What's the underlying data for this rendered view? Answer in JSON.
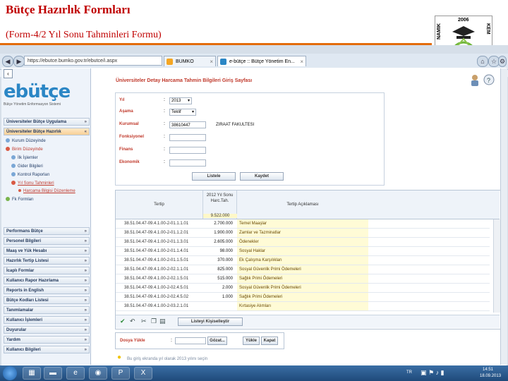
{
  "slide": {
    "title": "Bütçe Hazırlık Formları",
    "subtitle": "(Form-4/2 Yıl Sonu Tahminleri Formu)",
    "logo_year": "2006",
    "logo_left": "NAMIK",
    "logo_right": "KEM"
  },
  "browser": {
    "url": "https://ebutce.bumko.gov.tr/ebutce/i.aspx",
    "tabs": [
      {
        "label": "BUMKO"
      },
      {
        "label": "e-bütçe :: Bütçe Yönetim En..."
      }
    ]
  },
  "sidebar": {
    "brand": "ebütçe",
    "brand_sub": "Bütçe Yönetim Enformasyon Sistemi",
    "sections_top": [
      {
        "label": "Üniversiteler Bütçe Uygulama"
      },
      {
        "label": "Üniversiteler Bütçe Hazırlık"
      }
    ],
    "tree": [
      {
        "label": "Kurum Düzeyinde"
      },
      {
        "label": "Birim Düzeyinde"
      },
      {
        "label": "İlk İşlemler"
      },
      {
        "label": "Gider Bilgileri"
      },
      {
        "label": "Kontrol Raporları"
      },
      {
        "label": "Yıl Sonu Tahminleri"
      },
      {
        "label": "Harcama Bilgisi Düzenleme"
      },
      {
        "label": "Fk Formları"
      }
    ],
    "sections_bottom": [
      {
        "label": "Performans Bütçe"
      },
      {
        "label": "Personel Bilgileri"
      },
      {
        "label": "Maaş ve Yük Hesabı"
      },
      {
        "label": "Hazırlık Tertip Listesi"
      },
      {
        "label": "İcaplı Formlar"
      },
      {
        "label": "Kullanıcı Rapor Hazırlama"
      },
      {
        "label": "Reports in English"
      },
      {
        "label": "Bütçe Kodları Listesi"
      },
      {
        "label": "Tanımlamalar"
      },
      {
        "label": "Kullanıcı İşlemleri"
      },
      {
        "label": "Duyurular"
      },
      {
        "label": "Yardım"
      },
      {
        "label": "Kullanıcı Bilgileri"
      }
    ]
  },
  "form": {
    "heading": "Üniversiteler Detay Harcama Tahmin Bilgileri Giriş Sayfası",
    "fields": {
      "yil_label": "Yıl",
      "yil_value": "2013",
      "asama_label": "Aşama",
      "asama_value": "Teklif",
      "kurumsal_label": "Kurumsal",
      "kurumsal_value": "38610447",
      "kurumsal_name": "ZIRAAT FAKULTESI",
      "fonksiyonel_label": "Fonksiyonel",
      "finans_label": "Finans",
      "ekonomik_label": "Ekonomik"
    },
    "list_button": "Listele",
    "save_button": "Kaydet"
  },
  "grid": {
    "col_tertip": "Tertip",
    "col_value": "2012 Yıl Sonu Harc.Tah.",
    "col_total": "9.522.000",
    "col_desc": "Tertip Açıklaması",
    "rows": [
      {
        "tertip": "38.51.04.47-09.4.1.00-2-01.1.1.01",
        "value": "2.700.000",
        "desc": "Temel Maaşlar"
      },
      {
        "tertip": "38.51.04.47-09.4.1.00-2-01.1.2.01",
        "value": "1.900.000",
        "desc": "Zamlar ve Tazminatlar"
      },
      {
        "tertip": "38.51.04.47-09.4.1.00-2-01.1.3.01",
        "value": "2.605.000",
        "desc": "Ödenekler"
      },
      {
        "tertip": "38.51.04.47-09.4.1.00-2-01.1.4.01",
        "value": "98.000",
        "desc": "Sosyal Haklar"
      },
      {
        "tertip": "38.51.04.47-09.4.1.00-2-01.1.5.01",
        "value": "370.000",
        "desc": "Ek Çalışma Karşılıkları"
      },
      {
        "tertip": "38.51.04.47-09.4.1.00-2-02.1.1.01",
        "value": "825.000",
        "desc": "Sosyal Güvenlik Primi Ödemeleri"
      },
      {
        "tertip": "38.51.04.47-09.4.1.00-2-02.1.5.01",
        "value": "515.000",
        "desc": "Sağlık Primi Ödemeleri"
      },
      {
        "tertip": "38.51.04.47-09.4.1.00-2-02.4.5.01",
        "value": "2.000",
        "desc": "Sosyal Güvenlik Primi Ödemeleri"
      },
      {
        "tertip": "38.51.04.47-09.4.1.00-2-02.4.5.02",
        "value": "1.000",
        "desc": "Sağlık Primi Ödemeleri"
      },
      {
        "tertip": "38.51.04.47-09.4.1.00-2-03.2.1.01",
        "value": "",
        "desc": "Kırtasiye Alımları"
      }
    ],
    "tools_label": "Listeyi Kişiselleştir"
  },
  "upload": {
    "label": "Dosya Yükle",
    "browse": "Gözat...",
    "load": "Yükle",
    "close": "Kapat"
  },
  "footer": {
    "note": "Bu giriş ekranda yıl olarak 2013 yılını seçin"
  },
  "taskbar": {
    "lang": "TR",
    "time": "14:51",
    "date": "18.09.2013"
  }
}
